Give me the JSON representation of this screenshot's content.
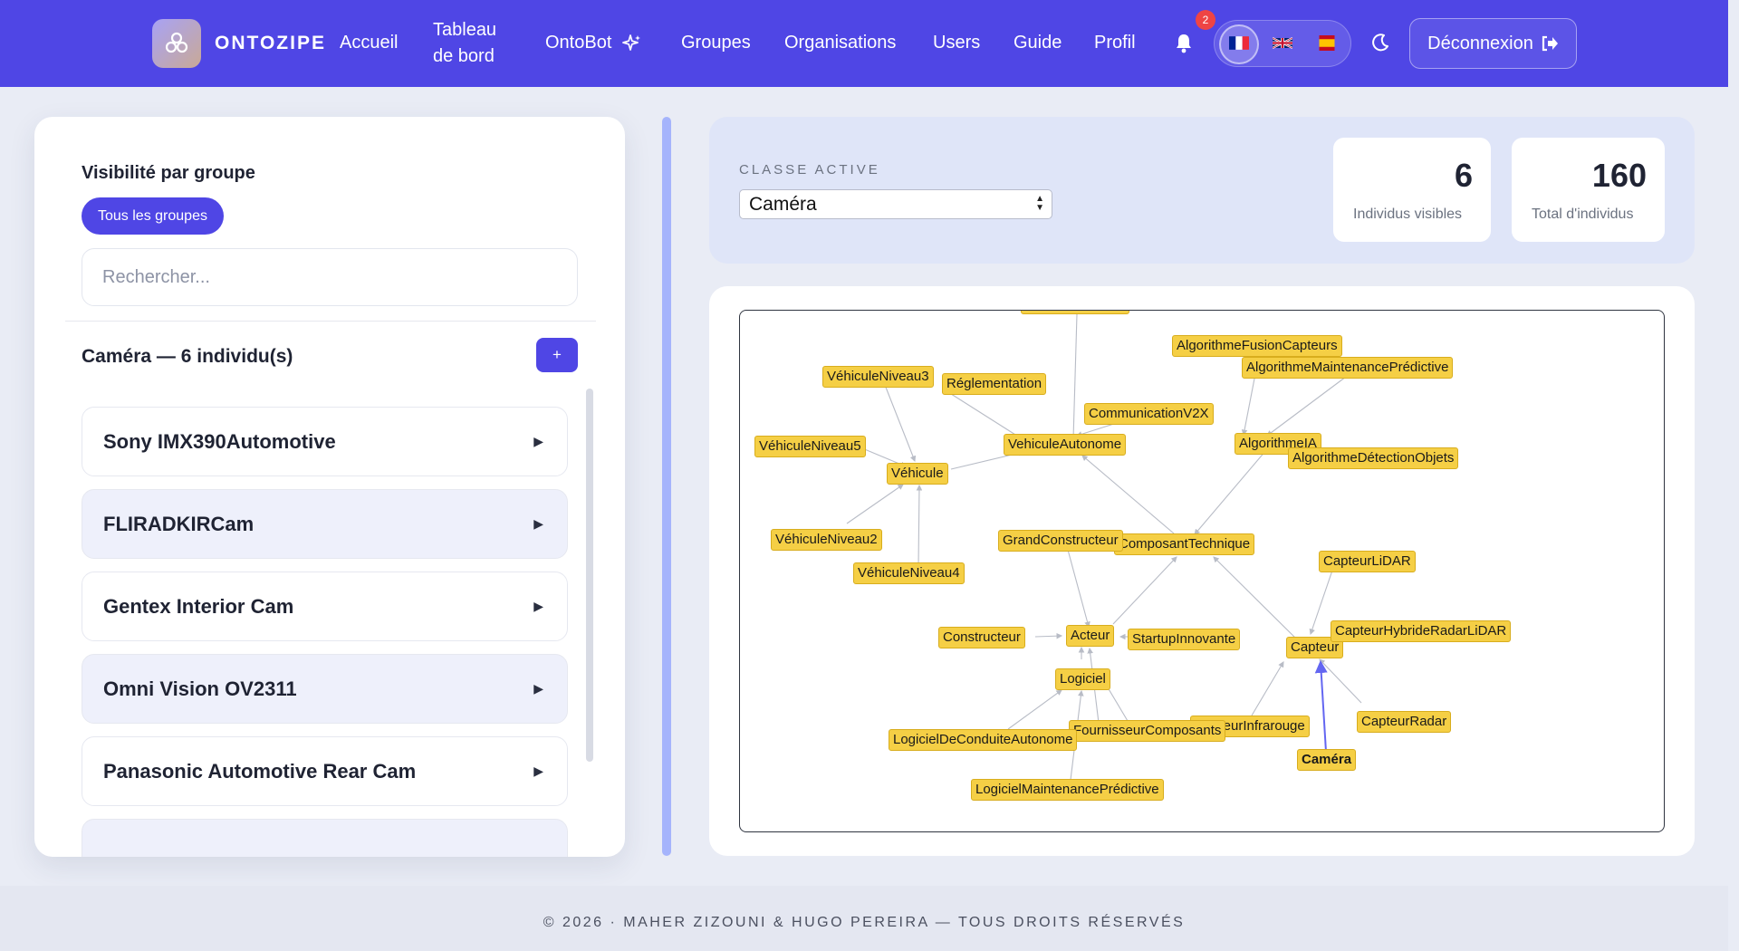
{
  "header": {
    "brand": "ONTOZIPE",
    "nav": {
      "accueil": "Accueil",
      "tableau_line1": "Tableau",
      "tableau_line2": "de bord",
      "ontobot": "OntoBot",
      "groupes": "Groupes",
      "organisations": "Organisations",
      "users": "Users",
      "guide": "Guide",
      "profil": "Profil"
    },
    "notifications_count": "2",
    "languages": [
      "fr",
      "en",
      "es"
    ],
    "active_language": "fr",
    "logout_label": "Déconnexion"
  },
  "left_panel": {
    "visibility_title": "Visibilité par groupe",
    "all_groups_label": "Tous les groupes",
    "search_placeholder": "Rechercher...",
    "class_heading": "Caméra — 6 individu(s)",
    "add_label": "+",
    "individuals": [
      {
        "name": "Sony IMX390Automotive"
      },
      {
        "name": "FLIRADKIRCam"
      },
      {
        "name": "Gentex Interior Cam"
      },
      {
        "name": "Omni Vision OV2311"
      },
      {
        "name": "Panasonic Automotive Rear Cam"
      }
    ]
  },
  "class_panel": {
    "label": "CLASSE ACTIVE",
    "selected_class": "Caméra",
    "visible_count": "6",
    "visible_label": "Individus visibles",
    "total_count": "160",
    "total_label": "Total d'individus"
  },
  "graph": {
    "nodes": {
      "vehicule_niveau3": "VéhiculeNiveau3",
      "reglementation": "Réglementation",
      "algo_fusion": "AlgorithmeFusionCapteurs",
      "algo_maintenance": "AlgorithmeMaintenancePrédictive",
      "communication_v2x": "CommunicationV2X",
      "vehicule_niveau5": "VéhiculeNiveau5",
      "vehicule_autonome": "VehiculeAutonome",
      "algorithme_ia": "AlgorithmeIA",
      "algo_detection": "AlgorithmeDétectionObjets",
      "vehicule": "Véhicule",
      "vehicule_niveau2": "VéhiculeNiveau2",
      "grand_constructeur": "GrandConstructeur",
      "composant_technique": "ComposantTechnique",
      "vehicule_niveau4": "VéhiculeNiveau4",
      "capteur_lidar": "CapteurLiDAR",
      "constructeur": "Constructeur",
      "acteur": "Acteur",
      "startup": "StartupInnovante",
      "capteur": "Capteur",
      "capteur_hybride": "CapteurHybrideRadarLiDAR",
      "logiciel": "Logiciel",
      "capteur_radar": "CapteurRadar",
      "fournisseur": "FournisseurComposants",
      "capteur_infrarouge": "CapteurInfrarouge",
      "logiciel_conduite": "LogicielDeConduiteAutonome",
      "camera": "Caméra",
      "logiciel_maintenance": "LogicielMaintenancePrédictive"
    },
    "highlight_color": "#6366f1",
    "node_color": "#f5cf45"
  },
  "footer": {
    "copyright": "© 2026 · MAHER ZIZOUNI & HUGO PEREIRA — TOUS DROITS RÉSERVÉS"
  },
  "colors": {
    "primary": "#4f46e5",
    "background": "#e9ecf5"
  }
}
